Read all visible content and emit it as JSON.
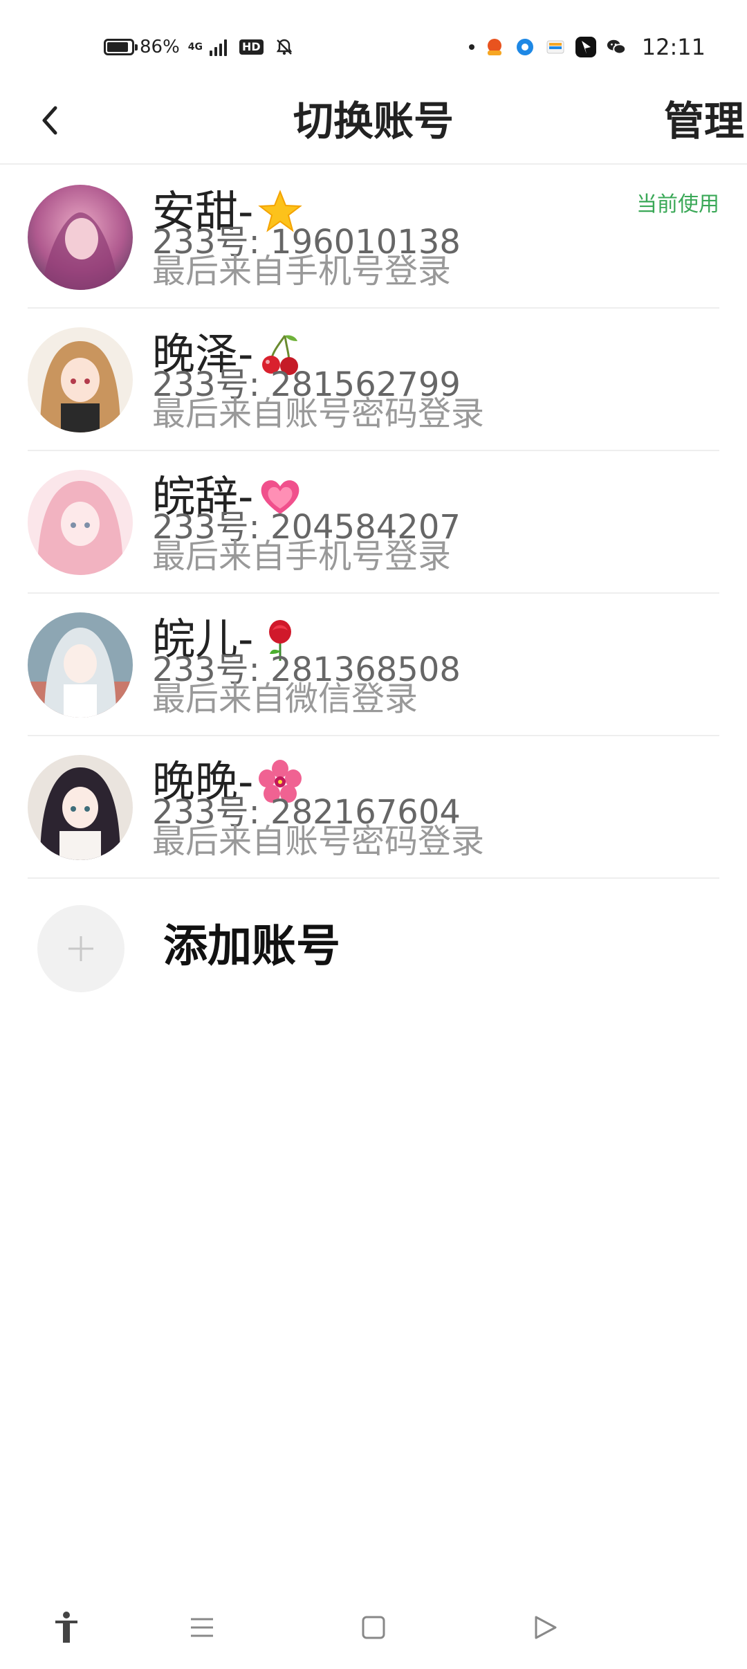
{
  "status_bar": {
    "battery_pct": "86%",
    "battery_level": 0.86,
    "network_type": "4G",
    "hd_label": "HD",
    "time": "12:11",
    "icons": [
      "battery-icon",
      "signal-icon",
      "hd-icon",
      "bell-off-icon",
      "dot-icon",
      "weather-app-icon",
      "browser-app-icon",
      "wallet-app-icon",
      "link-app-icon",
      "wechat-icon"
    ]
  },
  "header": {
    "back_icon": "chevron-left-icon",
    "title": "切换账号",
    "manage_label": "管理"
  },
  "accounts": [
    {
      "name": "安甜-",
      "emoji": "star",
      "uid": "233号: 196010138",
      "login_method": "最后来自手机号登录",
      "current_label": "当前使用",
      "avatar_color": "#c4709b"
    },
    {
      "name": "晚泽-",
      "emoji": "cherries",
      "uid": "233号: 281562799",
      "login_method": "最后来自账号密码登录",
      "current_label": "",
      "avatar_color": "#c39368"
    },
    {
      "name": "皖辞-",
      "emoji": "heart",
      "uid": "233号: 204584207",
      "login_method": "最后来自手机号登录",
      "current_label": "",
      "avatar_color": "#f0b7c4"
    },
    {
      "name": "皖儿-",
      "emoji": "rose",
      "uid": "233号: 281368508",
      "login_method": "最后来自微信登录",
      "current_label": "",
      "avatar_color": "#9fb4c0"
    },
    {
      "name": "晚晚-",
      "emoji": "hibiscus",
      "uid": "233号: 282167604",
      "login_method": "最后来自账号密码登录",
      "current_label": "",
      "avatar_color": "#d8cfc8"
    }
  ],
  "add_account": {
    "icon": "plus-icon",
    "label": "添加账号"
  },
  "nav_bar": {
    "buttons": [
      "accessibility-icon",
      "menu-icon",
      "home-icon",
      "back-triangle-icon"
    ]
  },
  "colors": {
    "accent_green": "#3aa857",
    "divider": "#eeeeee",
    "muted_text": "#999999"
  }
}
